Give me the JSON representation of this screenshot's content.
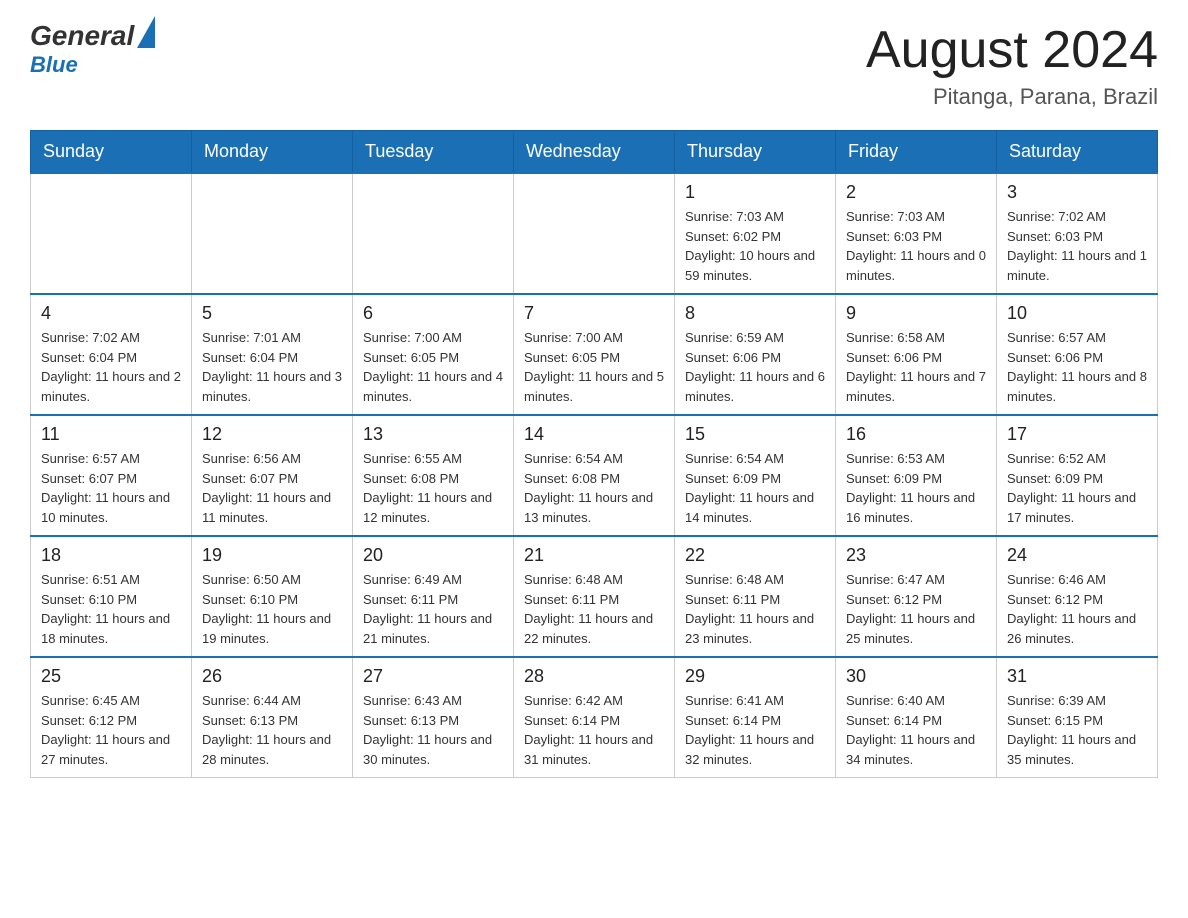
{
  "header": {
    "logo_general": "General",
    "logo_blue": "Blue",
    "month_title": "August 2024",
    "location": "Pitanga, Parana, Brazil"
  },
  "calendar": {
    "days_of_week": [
      "Sunday",
      "Monday",
      "Tuesday",
      "Wednesday",
      "Thursday",
      "Friday",
      "Saturday"
    ],
    "weeks": [
      [
        {
          "day": "",
          "info": ""
        },
        {
          "day": "",
          "info": ""
        },
        {
          "day": "",
          "info": ""
        },
        {
          "day": "",
          "info": ""
        },
        {
          "day": "1",
          "info": "Sunrise: 7:03 AM\nSunset: 6:02 PM\nDaylight: 10 hours and 59 minutes."
        },
        {
          "day": "2",
          "info": "Sunrise: 7:03 AM\nSunset: 6:03 PM\nDaylight: 11 hours and 0 minutes."
        },
        {
          "day": "3",
          "info": "Sunrise: 7:02 AM\nSunset: 6:03 PM\nDaylight: 11 hours and 1 minute."
        }
      ],
      [
        {
          "day": "4",
          "info": "Sunrise: 7:02 AM\nSunset: 6:04 PM\nDaylight: 11 hours and 2 minutes."
        },
        {
          "day": "5",
          "info": "Sunrise: 7:01 AM\nSunset: 6:04 PM\nDaylight: 11 hours and 3 minutes."
        },
        {
          "day": "6",
          "info": "Sunrise: 7:00 AM\nSunset: 6:05 PM\nDaylight: 11 hours and 4 minutes."
        },
        {
          "day": "7",
          "info": "Sunrise: 7:00 AM\nSunset: 6:05 PM\nDaylight: 11 hours and 5 minutes."
        },
        {
          "day": "8",
          "info": "Sunrise: 6:59 AM\nSunset: 6:06 PM\nDaylight: 11 hours and 6 minutes."
        },
        {
          "day": "9",
          "info": "Sunrise: 6:58 AM\nSunset: 6:06 PM\nDaylight: 11 hours and 7 minutes."
        },
        {
          "day": "10",
          "info": "Sunrise: 6:57 AM\nSunset: 6:06 PM\nDaylight: 11 hours and 8 minutes."
        }
      ],
      [
        {
          "day": "11",
          "info": "Sunrise: 6:57 AM\nSunset: 6:07 PM\nDaylight: 11 hours and 10 minutes."
        },
        {
          "day": "12",
          "info": "Sunrise: 6:56 AM\nSunset: 6:07 PM\nDaylight: 11 hours and 11 minutes."
        },
        {
          "day": "13",
          "info": "Sunrise: 6:55 AM\nSunset: 6:08 PM\nDaylight: 11 hours and 12 minutes."
        },
        {
          "day": "14",
          "info": "Sunrise: 6:54 AM\nSunset: 6:08 PM\nDaylight: 11 hours and 13 minutes."
        },
        {
          "day": "15",
          "info": "Sunrise: 6:54 AM\nSunset: 6:09 PM\nDaylight: 11 hours and 14 minutes."
        },
        {
          "day": "16",
          "info": "Sunrise: 6:53 AM\nSunset: 6:09 PM\nDaylight: 11 hours and 16 minutes."
        },
        {
          "day": "17",
          "info": "Sunrise: 6:52 AM\nSunset: 6:09 PM\nDaylight: 11 hours and 17 minutes."
        }
      ],
      [
        {
          "day": "18",
          "info": "Sunrise: 6:51 AM\nSunset: 6:10 PM\nDaylight: 11 hours and 18 minutes."
        },
        {
          "day": "19",
          "info": "Sunrise: 6:50 AM\nSunset: 6:10 PM\nDaylight: 11 hours and 19 minutes."
        },
        {
          "day": "20",
          "info": "Sunrise: 6:49 AM\nSunset: 6:11 PM\nDaylight: 11 hours and 21 minutes."
        },
        {
          "day": "21",
          "info": "Sunrise: 6:48 AM\nSunset: 6:11 PM\nDaylight: 11 hours and 22 minutes."
        },
        {
          "day": "22",
          "info": "Sunrise: 6:48 AM\nSunset: 6:11 PM\nDaylight: 11 hours and 23 minutes."
        },
        {
          "day": "23",
          "info": "Sunrise: 6:47 AM\nSunset: 6:12 PM\nDaylight: 11 hours and 25 minutes."
        },
        {
          "day": "24",
          "info": "Sunrise: 6:46 AM\nSunset: 6:12 PM\nDaylight: 11 hours and 26 minutes."
        }
      ],
      [
        {
          "day": "25",
          "info": "Sunrise: 6:45 AM\nSunset: 6:12 PM\nDaylight: 11 hours and 27 minutes."
        },
        {
          "day": "26",
          "info": "Sunrise: 6:44 AM\nSunset: 6:13 PM\nDaylight: 11 hours and 28 minutes."
        },
        {
          "day": "27",
          "info": "Sunrise: 6:43 AM\nSunset: 6:13 PM\nDaylight: 11 hours and 30 minutes."
        },
        {
          "day": "28",
          "info": "Sunrise: 6:42 AM\nSunset: 6:14 PM\nDaylight: 11 hours and 31 minutes."
        },
        {
          "day": "29",
          "info": "Sunrise: 6:41 AM\nSunset: 6:14 PM\nDaylight: 11 hours and 32 minutes."
        },
        {
          "day": "30",
          "info": "Sunrise: 6:40 AM\nSunset: 6:14 PM\nDaylight: 11 hours and 34 minutes."
        },
        {
          "day": "31",
          "info": "Sunrise: 6:39 AM\nSunset: 6:15 PM\nDaylight: 11 hours and 35 minutes."
        }
      ]
    ]
  }
}
